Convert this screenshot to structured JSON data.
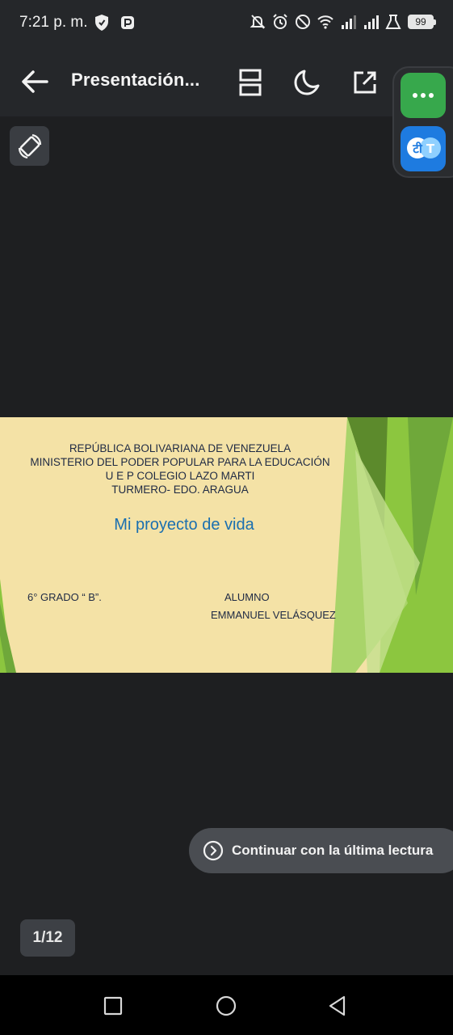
{
  "status_bar": {
    "time": "7:21 p. m.",
    "battery": "99",
    "icons": [
      "shield-icon",
      "app-notification-icon",
      "mute-icon",
      "alarm-icon",
      "do-not-disturb-icon",
      "wifi-icon",
      "signal-icon",
      "signal-icon",
      "lab-icon",
      "battery-icon"
    ]
  },
  "toolbar": {
    "title": "Presentación...",
    "icons": [
      "back-arrow-icon",
      "page-layout-icon",
      "night-mode-icon",
      "open-external-icon"
    ]
  },
  "floating_bubbles": {
    "top_icon": "more-dots-icon",
    "bottom_icon": "translate-icon",
    "translate_glyph_left": "टी",
    "translate_glyph_right": "T",
    "colors": {
      "green": "#37a84c",
      "blue": "#1e7be0"
    }
  },
  "slide": {
    "header_lines": [
      "REPÚBLICA BOLIVARIANA DE VENEZUELA",
      "MINISTERIO DEL PODER POPULAR PARA LA EDUCACIÓN",
      "U E P COLEGIO LAZO MARTI",
      "TURMERO- EDO. ARAGUA"
    ],
    "title": "Mi proyecto de vida",
    "grade": "6° GRADO “ B”.",
    "student_label": "ALUMNO",
    "student_name": "EMMANUEL VELÁSQUEZ",
    "colors": {
      "background": "#f4e2a6",
      "title": "#1a6fb0",
      "accent_green": "#8cc63f"
    }
  },
  "continue_chip": {
    "label": "Continuar con la última lectura",
    "icon": "chevron-circle-icon"
  },
  "page_indicator": {
    "text": "1/12"
  },
  "nav_bar": {
    "icons": [
      "recents-icon",
      "home-icon",
      "back-icon"
    ]
  }
}
